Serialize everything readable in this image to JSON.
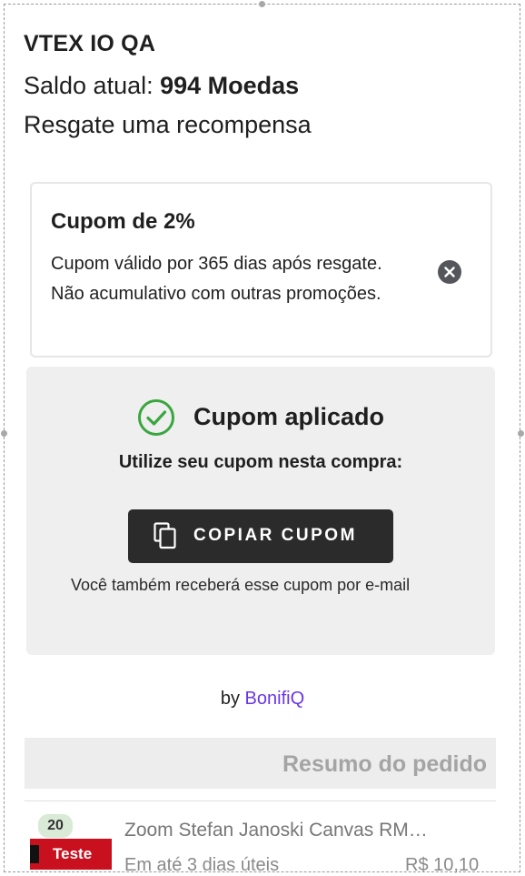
{
  "header": {
    "store_name": "VTEX IO QA",
    "balance_label": "Saldo atual:",
    "balance_value": "994 Moedas",
    "subtitle": "Resgate uma recompensa"
  },
  "reward": {
    "title": "Cupom de 2%",
    "description": "Cupom válido por 365 dias após resgate. Não acumulativo com outras promoções.",
    "close_icon": "close-circle-icon"
  },
  "applied": {
    "status": "Cupom aplicado",
    "status_icon": "check-circle-icon",
    "instruction": "Utilize seu cupom nesta compra:",
    "copy_label": "COPIAR CUPOM",
    "copy_icon": "copy-icon",
    "email_note": "Você também receberá esse cupom por e-mail"
  },
  "powered": {
    "prefix": "by",
    "brand": "BonifiQ"
  },
  "summary": {
    "title": "Resumo do pedido"
  },
  "cart_item": {
    "quantity": "20",
    "tag": "Teste",
    "name": "Zoom Stefan Janoski Canvas RM…",
    "subtitle": "Em até 3 dias úteis",
    "price": "R$ 10,10"
  },
  "colors": {
    "accent": "#6b36e6",
    "success": "#3aa640",
    "button_bg": "#2b2b2b",
    "tag_red": "#c8101f"
  }
}
